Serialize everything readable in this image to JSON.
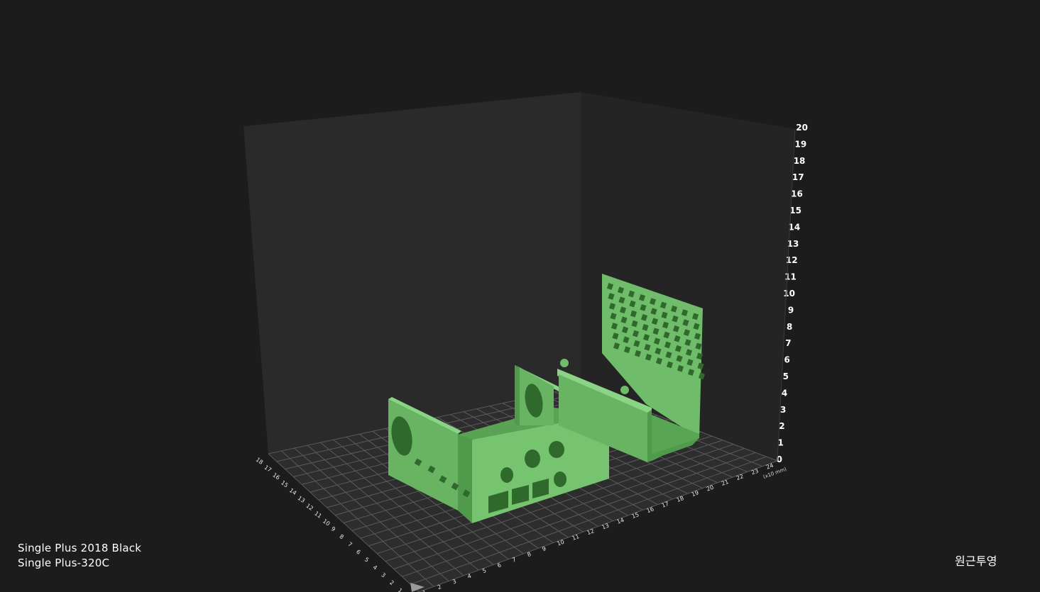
{
  "viewport": {
    "z_axis_ticks": [
      "0",
      "1",
      "2",
      "3",
      "4",
      "5",
      "6",
      "7",
      "8",
      "9",
      "10",
      "11",
      "12",
      "13",
      "14",
      "15",
      "16",
      "17",
      "18",
      "19",
      "20"
    ],
    "x_axis_ticks": [
      "1",
      "2",
      "3",
      "4",
      "5",
      "6",
      "7",
      "8",
      "9",
      "10",
      "11",
      "12",
      "13",
      "14",
      "15",
      "16",
      "17",
      "18",
      "19",
      "20",
      "21",
      "22",
      "23",
      "24"
    ],
    "y_axis_ticks": [
      "1",
      "2",
      "3",
      "4",
      "5",
      "6",
      "7",
      "8",
      "9",
      "10",
      "11",
      "12",
      "13",
      "14",
      "15",
      "16",
      "17",
      "18"
    ],
    "x_axis_unit": "(x10 mm)",
    "colors": {
      "background": "#1c1c1c",
      "back_wall": "#2a2a2b",
      "side_wall": "#242425",
      "floor": "#2e2e2e",
      "grid": "#5a5a5a",
      "model_fill": "#6fbd6a",
      "model_shade": "#4f9a4b",
      "model_dark": "#2f6a2c"
    }
  },
  "machine": {
    "name": "Single Plus 2018 Black",
    "model": "Single Plus-320C"
  },
  "projection": {
    "label": "원근투영"
  }
}
